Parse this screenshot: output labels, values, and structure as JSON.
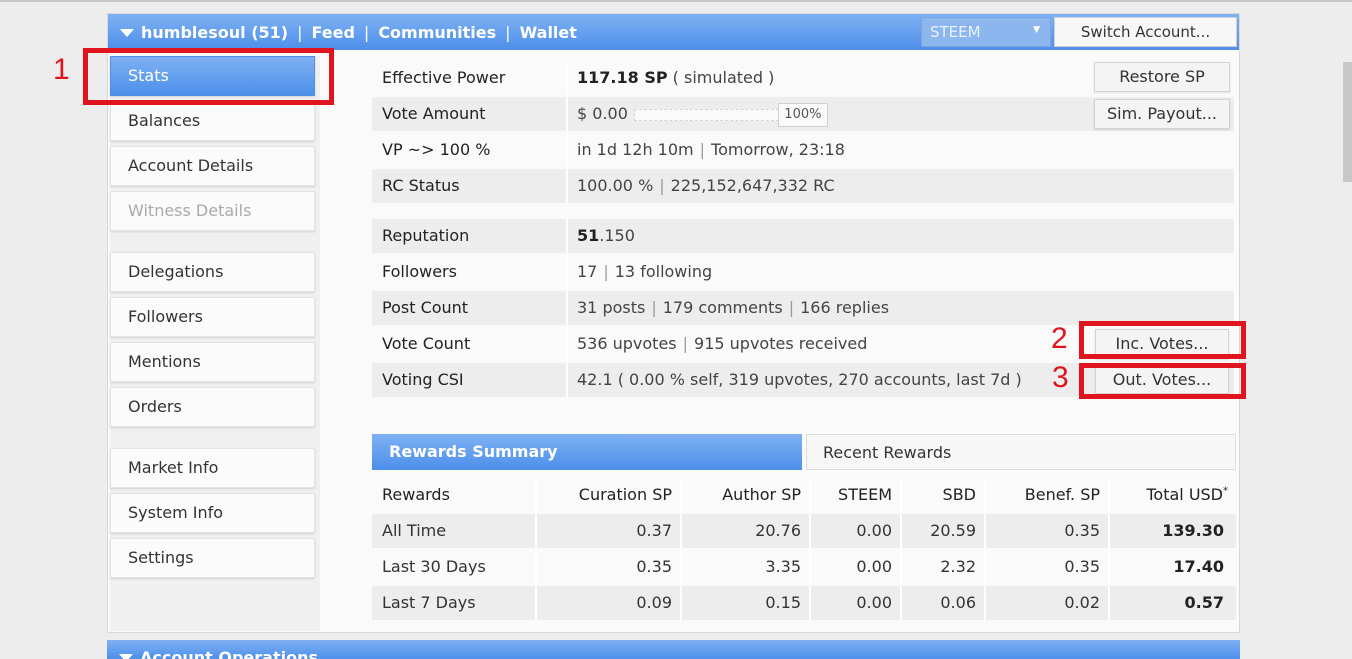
{
  "header": {
    "user": "humblesoul (51)",
    "sep": "|",
    "nav": [
      "Feed",
      "Communities",
      "Wallet"
    ],
    "coin_select": "STEEM",
    "switch_label": "Switch Account..."
  },
  "sidebar": {
    "items": [
      {
        "label": "Stats"
      },
      {
        "label": "Balances"
      },
      {
        "label": "Account Details"
      },
      {
        "label": "Witness Details"
      },
      {
        "label": "Delegations"
      },
      {
        "label": "Followers"
      },
      {
        "label": "Mentions"
      },
      {
        "label": "Orders"
      },
      {
        "label": "Market Info"
      },
      {
        "label": "System Info"
      },
      {
        "label": "Settings"
      }
    ]
  },
  "stats": {
    "effective_power": {
      "label": "Effective Power",
      "value": "117.18 SP",
      "suffix": "( simulated )",
      "button": "Restore SP"
    },
    "vote_amount": {
      "label": "Vote Amount",
      "value": "$ 0.00",
      "slider": "100%",
      "slider_fraction": 1.0,
      "button": "Sim. Payout..."
    },
    "vp": {
      "label": "VP ~> 100 %",
      "value_a": "in 1d 12h 10m",
      "value_b": "Tomorrow, 23:18"
    },
    "rc": {
      "label": "RC Status",
      "value_a": "100.00 %",
      "value_b": "225,152,647,332 RC"
    },
    "reputation": {
      "label": "Reputation",
      "value_bold": "51",
      "value_rest": ".150"
    },
    "followers": {
      "label": "Followers",
      "value_a": "17",
      "value_b": "13 following"
    },
    "post_count": {
      "label": "Post Count",
      "value_a": "31 posts",
      "value_b": "179 comments",
      "value_c": "166 replies"
    },
    "vote_count": {
      "label": "Vote Count",
      "value_a": "536 upvotes",
      "value_b": "915 upvotes received",
      "button": "Inc. Votes..."
    },
    "voting_csi": {
      "label": "Voting CSI",
      "value": "42.1 ( 0.00 % self, 319 upvotes, 270 accounts, last 7d )",
      "button": "Out. Votes..."
    }
  },
  "rewards": {
    "tabs": [
      "Rewards Summary",
      "Recent Rewards"
    ],
    "headers": [
      "Rewards",
      "Curation SP",
      "Author SP",
      "STEEM",
      "SBD",
      "Benef. SP",
      "Total USD"
    ],
    "total_marker": "*",
    "rows": [
      [
        "All Time",
        "0.37",
        "20.76",
        "0.00",
        "20.59",
        "0.35",
        "139.30"
      ],
      [
        "Last 30 Days",
        "0.35",
        "3.35",
        "0.00",
        "2.32",
        "0.35",
        "17.40"
      ],
      [
        "Last 7 Days",
        "0.09",
        "0.15",
        "0.00",
        "0.06",
        "0.02",
        "0.57"
      ]
    ]
  },
  "annotations": [
    "1",
    "2",
    "3"
  ],
  "bottom": {
    "label": "Account Operations"
  },
  "colors": {
    "accent": "#4d8fea",
    "annotation": "#e0141e"
  }
}
